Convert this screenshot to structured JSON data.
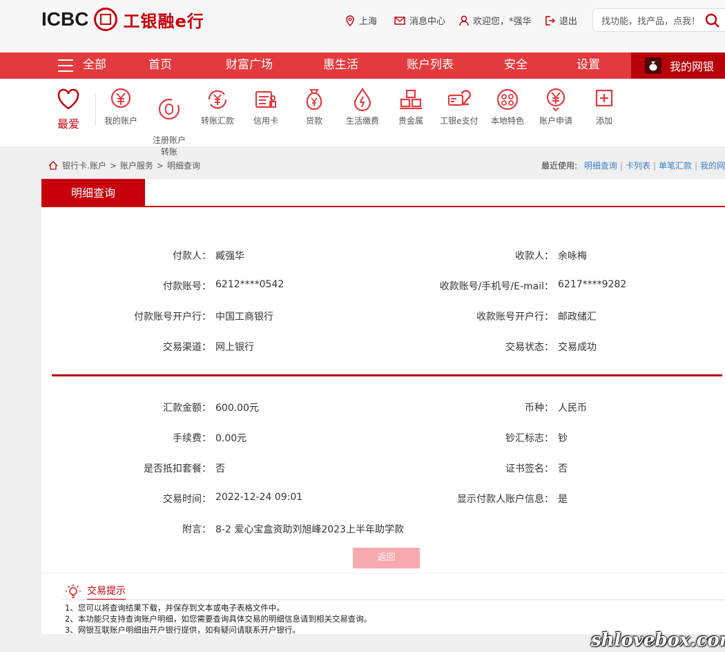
{
  "header": {
    "logo_en": "ICBC",
    "logo_cn": "工银融e行",
    "location": "上海",
    "messages": "消息中心",
    "welcome": "欢迎您，*强华",
    "logout": "退出",
    "search_placeholder": "找功能，找产品，点我！"
  },
  "nav": {
    "all": "全部",
    "items": [
      "首页",
      "财富广场",
      "惠生活",
      "账户列表",
      "安全",
      "设置"
    ],
    "mybank": "我的网银"
  },
  "quick": {
    "favorite": "最爱",
    "items": [
      "我的账户",
      "注册账户\n转账",
      "转账汇款",
      "信用卡",
      "贷款",
      "生活缴费",
      "贵金属",
      "工银e支付",
      "本地特色",
      "账户申请",
      "添加"
    ]
  },
  "breadcrumb": {
    "path": [
      "银行卡.账户",
      "账户服务",
      "明细查询"
    ],
    "recent_label": "最近使用:",
    "recent_links": [
      "明细查询",
      "卡列表",
      "单笔汇款",
      "我的网银"
    ]
  },
  "tab": "明细查询",
  "details_top": {
    "left": [
      {
        "label": "付款人：",
        "value": "臧强华"
      },
      {
        "label": "付款账号：",
        "value": "6212****0542"
      },
      {
        "label": "付款账号开户行：",
        "value": "中国工商银行"
      },
      {
        "label": "交易渠道：",
        "value": "网上银行"
      }
    ],
    "right": [
      {
        "label": "收款人：",
        "value": "余咏梅"
      },
      {
        "label": "收款账号/手机号/E-mail：",
        "value": "6217****9282"
      },
      {
        "label": "收款账号开户行：",
        "value": "邮政储汇"
      },
      {
        "label": "交易状态：",
        "value": "交易成功"
      }
    ]
  },
  "details_bottom": {
    "left": [
      {
        "label": "汇款金额：",
        "value": "600.00元"
      },
      {
        "label": "手续费：",
        "value": "0.00元"
      },
      {
        "label": "是否抵扣套餐：",
        "value": "否"
      },
      {
        "label": "交易时间：",
        "value": "2022-12-24 09:01"
      },
      {
        "label": "附言：",
        "value": "8-2 爱心宝盒资助刘旭峰2023上半年助学款"
      }
    ],
    "right": [
      {
        "label": "币种：",
        "value": "人民币"
      },
      {
        "label": "钞汇标志：",
        "value": "钞"
      },
      {
        "label": "证书签名：",
        "value": "否"
      },
      {
        "label": "显示付款人账户信息：",
        "value": "是"
      }
    ]
  },
  "back_button": "返回",
  "tips": {
    "title": "交易提示",
    "lines": [
      "1、您可以将查询结果下载，并保存到文本或电子表格文件中。",
      "2、本功能只支持查询账户明细，如您需要查询具体交易的明细信息请到相关交易查询。",
      "3、网银互联账户明细由开户银行提供，如有疑问请联系开户银行。"
    ]
  },
  "watermark": "shlovebox.com",
  "colors": {
    "brand_red": "#c7000b",
    "nav_red": "#e23a3f",
    "link_blue": "#3a7fc4"
  }
}
